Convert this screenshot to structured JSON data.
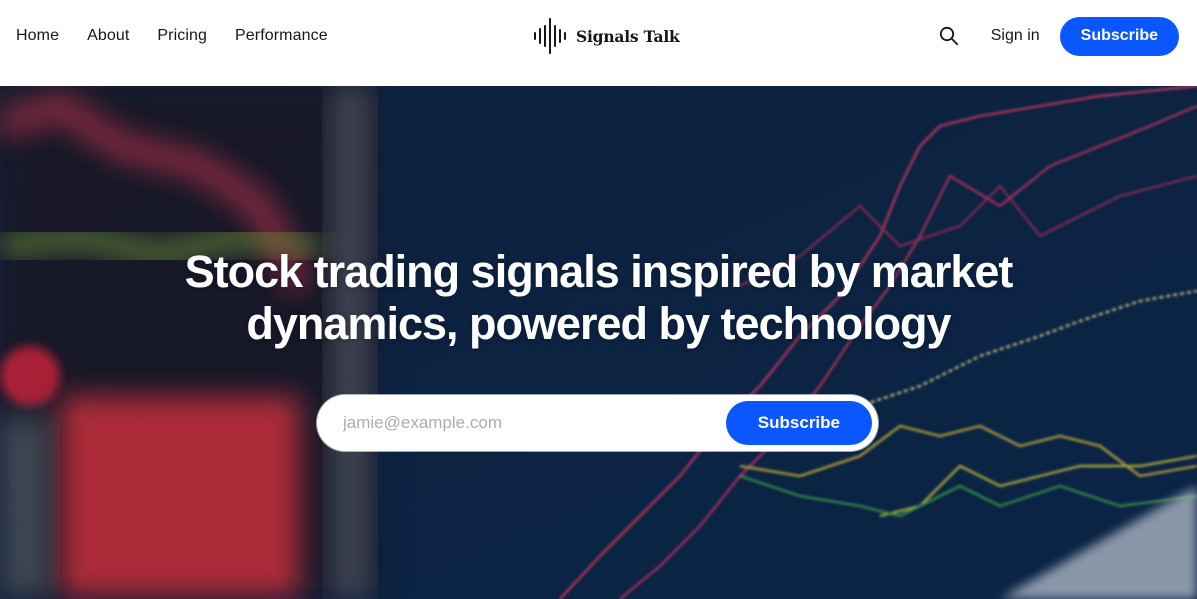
{
  "nav": {
    "items": [
      {
        "label": "Home"
      },
      {
        "label": "About"
      },
      {
        "label": "Pricing"
      },
      {
        "label": "Performance"
      }
    ]
  },
  "brand": {
    "name": "Signals Talk",
    "logo_icon": "soundwave-icon"
  },
  "header_actions": {
    "search_icon": "search-icon",
    "signin_label": "Sign in",
    "subscribe_label": "Subscribe"
  },
  "hero": {
    "title_line1": "Stock trading signals inspired by market",
    "title_line2": "dynamics, powered by technology",
    "email_placeholder": "jamie@example.com",
    "subscribe_label": "Subscribe"
  },
  "colors": {
    "accent": "#0b57ff",
    "text": "#15171a",
    "hero_bg": "#0b2446"
  }
}
